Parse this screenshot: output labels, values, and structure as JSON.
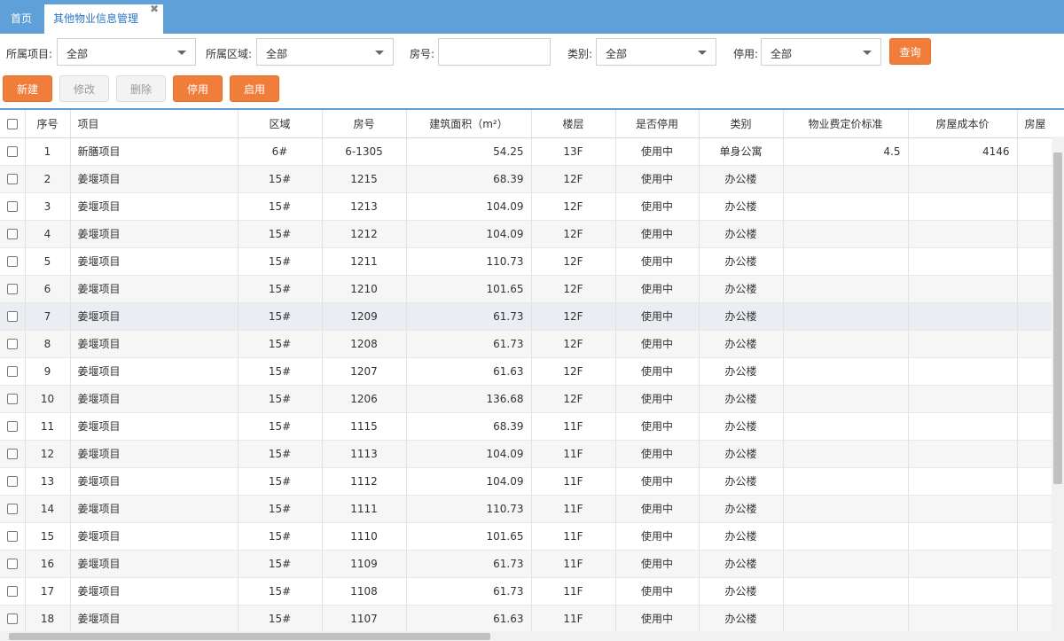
{
  "tabs": {
    "home": "首页",
    "active": "其他物业信息管理",
    "close": "✖"
  },
  "filters": {
    "project_label": "所属项目:",
    "project_value": "全部",
    "area_label": "所属区域:",
    "area_value": "全部",
    "room_label": "房号:",
    "room_value": "",
    "category_label": "类别:",
    "category_value": "全部",
    "disabled_label": "停用:",
    "disabled_value": "全部",
    "query_label": "查询"
  },
  "toolbar": {
    "new": "新建",
    "edit": "修改",
    "delete": "删除",
    "disable": "停用",
    "enable": "启用"
  },
  "columns": [
    "序号",
    "项目",
    "区域",
    "房号",
    "建筑面积（m²）",
    "楼层",
    "是否停用",
    "类别",
    "物业费定价标准",
    "房屋成本价",
    "房屋"
  ],
  "rows": [
    [
      "1",
      "新膳项目",
      "6#",
      "6-1305",
      "54.25",
      "13F",
      "使用中",
      "单身公寓",
      "4.5",
      "4146"
    ],
    [
      "2",
      "姜堰项目",
      "15#",
      "1215",
      "68.39",
      "12F",
      "使用中",
      "办公楼",
      "",
      ""
    ],
    [
      "3",
      "姜堰项目",
      "15#",
      "1213",
      "104.09",
      "12F",
      "使用中",
      "办公楼",
      "",
      ""
    ],
    [
      "4",
      "姜堰项目",
      "15#",
      "1212",
      "104.09",
      "12F",
      "使用中",
      "办公楼",
      "",
      ""
    ],
    [
      "5",
      "姜堰项目",
      "15#",
      "1211",
      "110.73",
      "12F",
      "使用中",
      "办公楼",
      "",
      ""
    ],
    [
      "6",
      "姜堰项目",
      "15#",
      "1210",
      "101.65",
      "12F",
      "使用中",
      "办公楼",
      "",
      ""
    ],
    [
      "7",
      "姜堰项目",
      "15#",
      "1209",
      "61.73",
      "12F",
      "使用中",
      "办公楼",
      "",
      ""
    ],
    [
      "8",
      "姜堰项目",
      "15#",
      "1208",
      "61.73",
      "12F",
      "使用中",
      "办公楼",
      "",
      ""
    ],
    [
      "9",
      "姜堰项目",
      "15#",
      "1207",
      "61.63",
      "12F",
      "使用中",
      "办公楼",
      "",
      ""
    ],
    [
      "10",
      "姜堰项目",
      "15#",
      "1206",
      "136.68",
      "12F",
      "使用中",
      "办公楼",
      "",
      ""
    ],
    [
      "11",
      "姜堰项目",
      "15#",
      "1115",
      "68.39",
      "11F",
      "使用中",
      "办公楼",
      "",
      ""
    ],
    [
      "12",
      "姜堰项目",
      "15#",
      "1113",
      "104.09",
      "11F",
      "使用中",
      "办公楼",
      "",
      ""
    ],
    [
      "13",
      "姜堰项目",
      "15#",
      "1112",
      "104.09",
      "11F",
      "使用中",
      "办公楼",
      "",
      ""
    ],
    [
      "14",
      "姜堰项目",
      "15#",
      "1111",
      "110.73",
      "11F",
      "使用中",
      "办公楼",
      "",
      ""
    ],
    [
      "15",
      "姜堰项目",
      "15#",
      "1110",
      "101.65",
      "11F",
      "使用中",
      "办公楼",
      "",
      ""
    ],
    [
      "16",
      "姜堰项目",
      "15#",
      "1109",
      "61.73",
      "11F",
      "使用中",
      "办公楼",
      "",
      ""
    ],
    [
      "17",
      "姜堰项目",
      "15#",
      "1108",
      "61.73",
      "11F",
      "使用中",
      "办公楼",
      "",
      ""
    ],
    [
      "18",
      "姜堰项目",
      "15#",
      "1107",
      "61.63",
      "11F",
      "使用中",
      "办公楼",
      "",
      ""
    ]
  ],
  "colors": {
    "accent": "#5fa0d8",
    "button": "#f07e3a",
    "highlight_row": "#eaeef3"
  }
}
